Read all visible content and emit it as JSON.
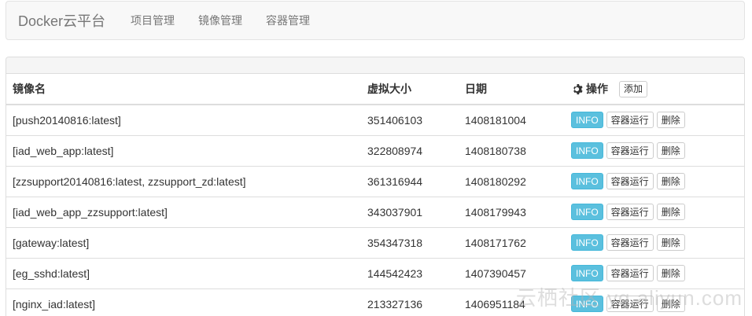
{
  "navbar": {
    "brand": "Docker云平台",
    "links": [
      "项目管理",
      "镜像管理",
      "容器管理"
    ]
  },
  "table": {
    "headers": {
      "name": "镜像名",
      "size": "虚拟大小",
      "date": "日期",
      "ops": "操作",
      "add": "添加"
    },
    "row_buttons": {
      "info": "INFO",
      "run": "容器运行",
      "delete": "删除"
    },
    "rows": [
      {
        "name": "[push20140816:latest]",
        "size": "351406103",
        "date": "1408181004"
      },
      {
        "name": "[iad_web_app:latest]",
        "size": "322808974",
        "date": "1408180738"
      },
      {
        "name": "[zzsupport20140816:latest, zzsupport_zd:latest]",
        "size": "361316944",
        "date": "1408180292"
      },
      {
        "name": "[iad_web_app_zzsupport:latest]",
        "size": "343037901",
        "date": "1408179943"
      },
      {
        "name": "[gateway:latest]",
        "size": "354347318",
        "date": "1408171762"
      },
      {
        "name": "[eg_sshd:latest]",
        "size": "144542423",
        "date": "1407390457"
      },
      {
        "name": "[nginx_iad:latest]",
        "size": "213327136",
        "date": "1406951184"
      }
    ]
  },
  "watermark": "云栖社区 yq.aliyun.com",
  "colors": {
    "info_button": "#5bc0de",
    "navbar_bg": "#f8f8f8",
    "border": "#dddddd"
  }
}
